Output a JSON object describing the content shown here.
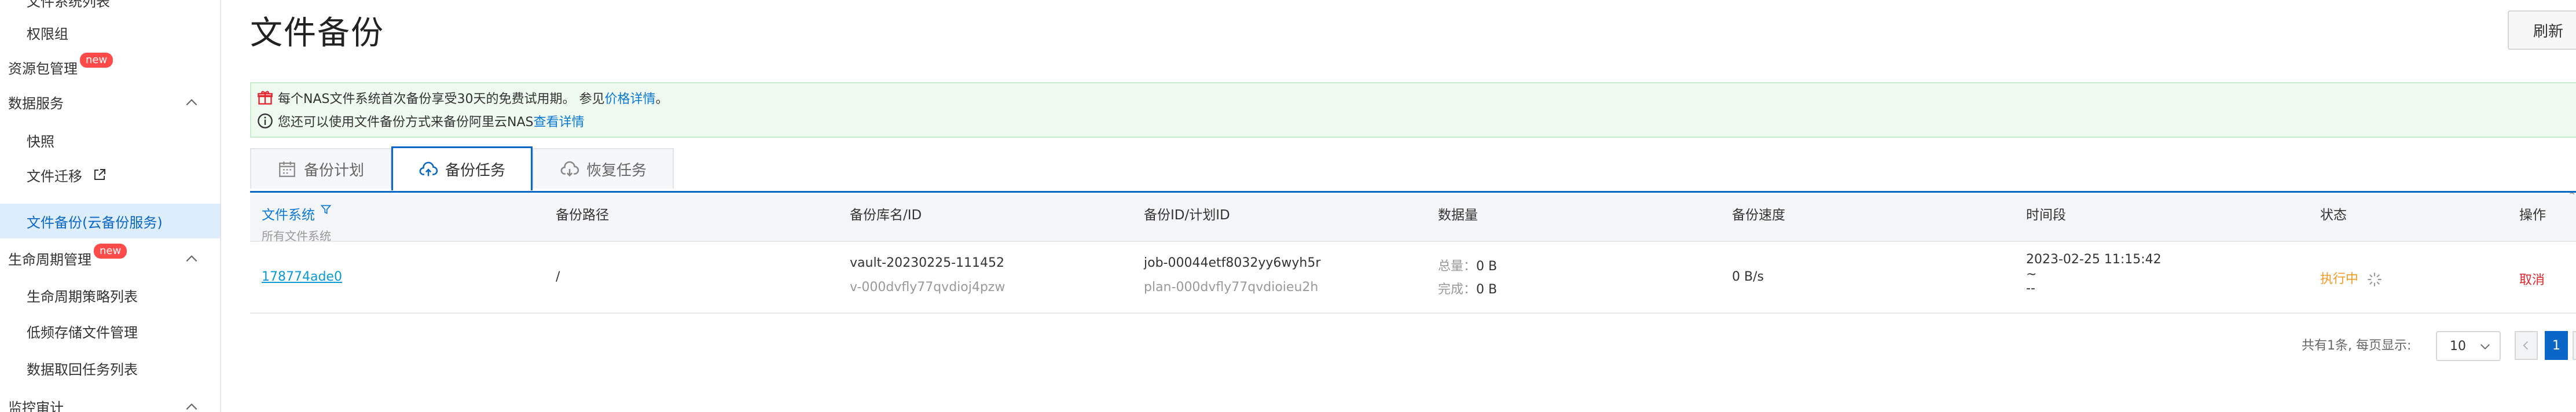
{
  "sidebar": {
    "items": [
      {
        "label": "文件系统列表",
        "type": "sub"
      },
      {
        "label": "权限组",
        "type": "sub"
      },
      {
        "label": "资源包管理",
        "type": "group",
        "badge": "new"
      },
      {
        "label": "数据服务",
        "type": "group",
        "expanded": true
      },
      {
        "label": "快照",
        "type": "sub"
      },
      {
        "label": "文件迁移",
        "type": "sub",
        "external": true
      },
      {
        "label": "文件备份(云备份服务)",
        "type": "sub",
        "active": true
      },
      {
        "label": "生命周期管理",
        "type": "group",
        "badge": "new",
        "expanded": true
      },
      {
        "label": "生命周期策略列表",
        "type": "sub"
      },
      {
        "label": "低频存储文件管理",
        "type": "sub"
      },
      {
        "label": "数据取回任务列表",
        "type": "sub"
      },
      {
        "label": "监控审计",
        "type": "group",
        "expanded": true
      }
    ]
  },
  "header": {
    "title": "文件备份",
    "refresh_label": "刷新"
  },
  "notice": {
    "line1_prefix": "每个NAS文件系统首次备份享受30天的免费试用期。 参见",
    "line1_link": "价格详情",
    "line1_suffix": "。",
    "line2_prefix": "您还可以使用文件备份方式来备份阿里云NAS ",
    "line2_link": "查看详情"
  },
  "tabs": [
    {
      "label": "备份计划",
      "icon": "calendar-icon",
      "active": false
    },
    {
      "label": "备份任务",
      "icon": "cloud-upload-icon",
      "active": true
    },
    {
      "label": "恢复任务",
      "icon": "cloud-download-icon",
      "active": false
    }
  ],
  "table": {
    "columns": [
      {
        "label": "文件系统",
        "sub": "所有文件系统"
      },
      {
        "label": "备份路径"
      },
      {
        "label": "备份库名/ID"
      },
      {
        "label": "备份ID/计划ID"
      },
      {
        "label": "数据量"
      },
      {
        "label": "备份速度"
      },
      {
        "label": "时间段"
      },
      {
        "label": "状态"
      },
      {
        "label": "操作"
      }
    ],
    "edge_number": "22",
    "rows": [
      {
        "file_system": "178774ade0",
        "path": "/",
        "vault_name": "vault-20230225-111452",
        "vault_id": "v-000dvfly77qvdioj4pzw",
        "job_id": "job-00044etf8032yy6wyh5r",
        "plan_id": "plan-000dvfly77qvdioieu2h",
        "total_label": "总量：",
        "total_value": "0 B",
        "done_label": "完成：",
        "done_value": "0 B",
        "speed": "0 B/s",
        "time_start": "2023-02-25 11:15:42",
        "time_sep": "~",
        "time_end": "--",
        "status": "执行中",
        "action": "取消"
      }
    ]
  },
  "pagination": {
    "summary": "共有1条, 每页显示:",
    "page_size": "10",
    "current_page": "1"
  },
  "colors": {
    "accent": "#0a67c8",
    "running": "#f59a23",
    "danger": "#e3262f",
    "notice_bg": "#eef9ef",
    "badge": "#ff4a4a"
  }
}
